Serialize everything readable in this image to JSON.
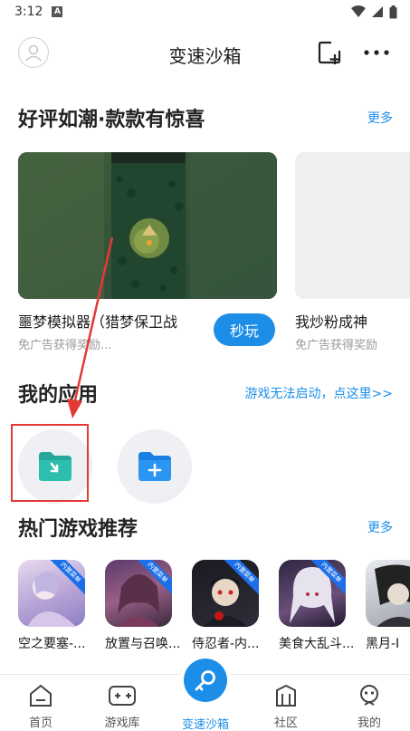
{
  "status_bar": {
    "time": "3:12",
    "notif_letter": "A"
  },
  "header": {
    "title": "变速沙箱"
  },
  "featured": {
    "title": "好评如潮·款款有惊喜",
    "more": "更多",
    "cards": [
      {
        "name": "噩梦模拟器（猎梦保卫战",
        "sub": "免广告获得奖励...",
        "button": "秒玩"
      },
      {
        "name": "我炒粉成神",
        "sub": "免广告获得奖励"
      }
    ]
  },
  "my_apps": {
    "title": "我的应用",
    "link": "游戏无法启动，点这里>>"
  },
  "hot_games": {
    "title": "热门游戏推荐",
    "more": "更多",
    "ribbon": "内置菜单",
    "items": [
      {
        "name": "空之要塞-..."
      },
      {
        "name": "放置与召唤..."
      },
      {
        "name": "侍忍者-内..."
      },
      {
        "name": "美食大乱斗..."
      },
      {
        "name": "黑月-I"
      }
    ]
  },
  "tabs": [
    {
      "label": "首页"
    },
    {
      "label": "游戏库"
    },
    {
      "label": "变速沙箱"
    },
    {
      "label": "社区"
    },
    {
      "label": "我的"
    }
  ],
  "colors": {
    "accent": "#1c8ee8",
    "highlight": "#e53935"
  }
}
